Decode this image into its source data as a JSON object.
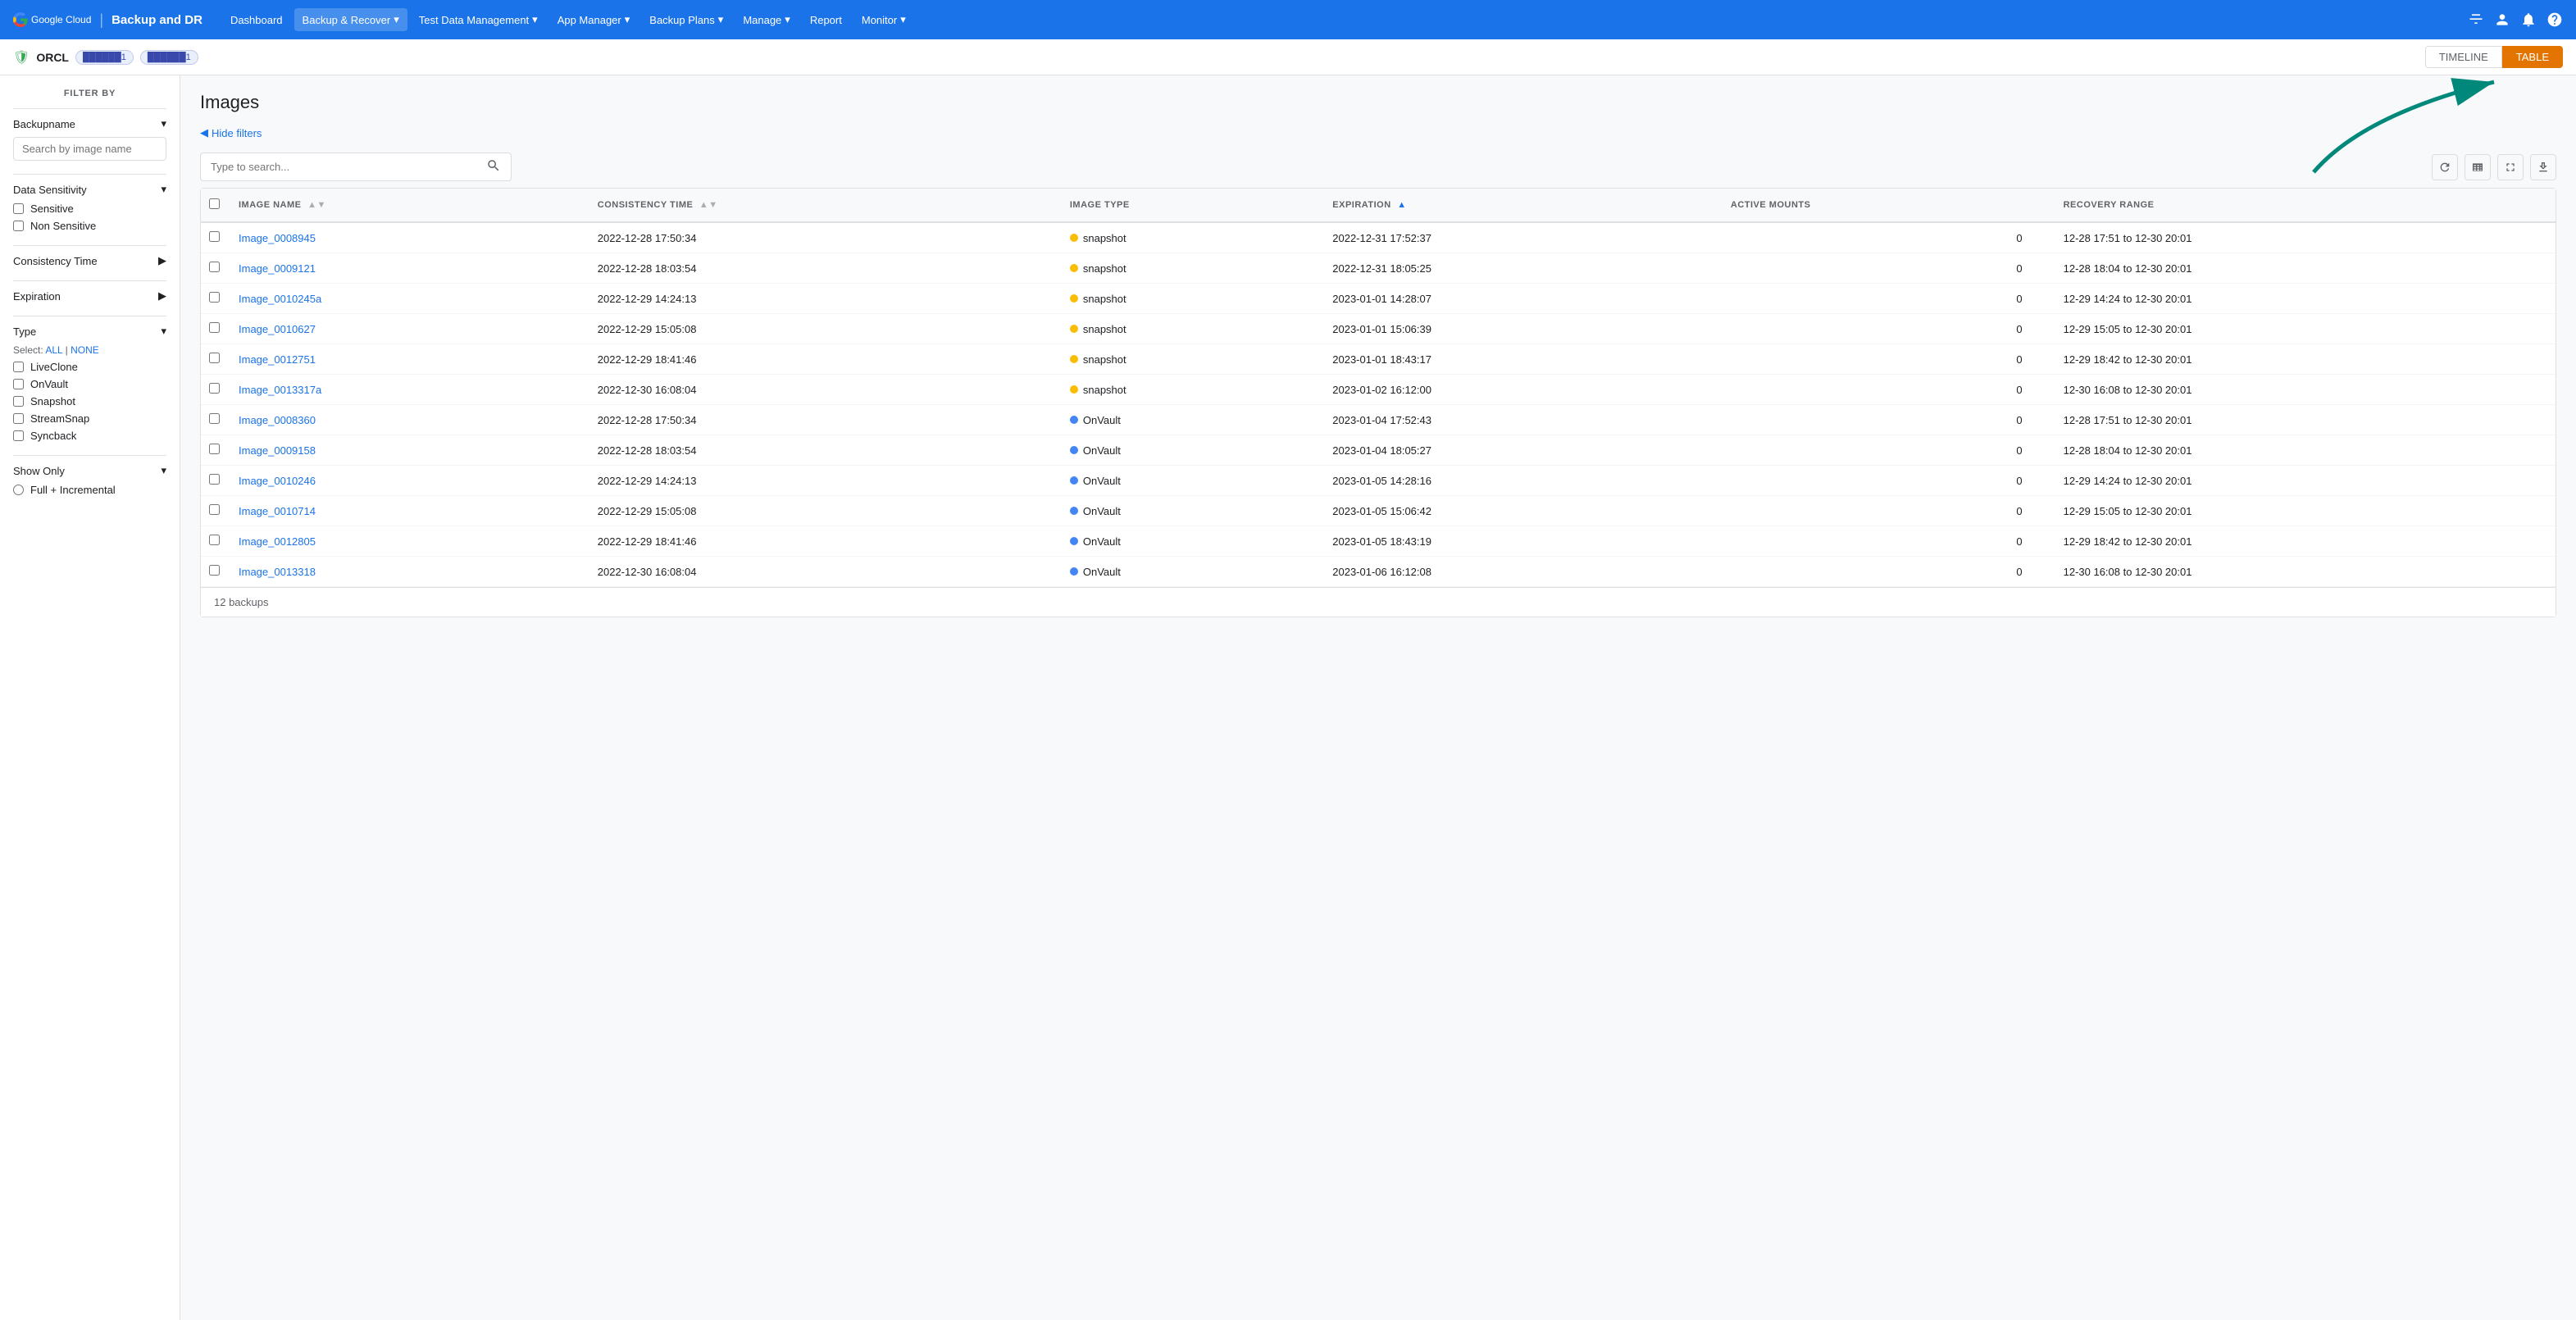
{
  "nav": {
    "brand": "Google Cloud",
    "product": "Backup and DR",
    "links": [
      {
        "label": "Dashboard",
        "hasDropdown": false
      },
      {
        "label": "Backup & Recover",
        "hasDropdown": true
      },
      {
        "label": "Test Data Management",
        "hasDropdown": true
      },
      {
        "label": "App Manager",
        "hasDropdown": true
      },
      {
        "label": "Backup Plans",
        "hasDropdown": true
      },
      {
        "label": "Manage",
        "hasDropdown": true
      },
      {
        "label": "Report",
        "hasDropdown": false
      },
      {
        "label": "Monitor",
        "hasDropdown": true
      }
    ]
  },
  "subnav": {
    "instance": "ORCL",
    "badge1": "●●●●●1",
    "badge2": "●●●●●1",
    "timeline_label": "TIMELINE",
    "table_label": "TABLE"
  },
  "sidebar": {
    "title": "FILTER BY",
    "sections": [
      {
        "label": "Backupname",
        "type": "search",
        "placeholder": "Search by image name"
      },
      {
        "label": "Data Sensitivity",
        "type": "checkboxes",
        "items": [
          "Sensitive",
          "Non Sensitive"
        ]
      },
      {
        "label": "Consistency Time",
        "type": "arrow"
      },
      {
        "label": "Expiration",
        "type": "arrow"
      },
      {
        "label": "Type",
        "type": "checkboxes_with_select",
        "select_all": "ALL",
        "select_none": "NONE",
        "items": [
          "LiveClone",
          "OnVault",
          "Snapshot",
          "StreamSnap",
          "Syncback"
        ]
      },
      {
        "label": "Show Only",
        "type": "radio",
        "items": [
          "Full + Incremental"
        ]
      }
    ]
  },
  "main": {
    "title": "Images",
    "hide_filters": "Hide filters",
    "search_placeholder": "Type to search...",
    "footer": "12 backups",
    "columns": [
      {
        "label": "IMAGE NAME",
        "sortable": true
      },
      {
        "label": "CONSISTENCY TIME",
        "sortable": true
      },
      {
        "label": "IMAGE TYPE",
        "sortable": false
      },
      {
        "label": "EXPIRATION",
        "sortable": true,
        "sort_dir": "desc"
      },
      {
        "label": "ACTIVE MOUNTS",
        "sortable": false
      },
      {
        "label": "RECOVERY RANGE",
        "sortable": false
      }
    ],
    "rows": [
      {
        "name": "Image_0008945",
        "consistency": "2022-12-28 17:50:34",
        "type": "snapshot",
        "expiration": "2022-12-31 17:52:37",
        "active_mounts": "0",
        "recovery_range": "12-28 17:51 to 12-30 20:01"
      },
      {
        "name": "Image_0009121",
        "consistency": "2022-12-28 18:03:54",
        "type": "snapshot",
        "expiration": "2022-12-31 18:05:25",
        "active_mounts": "0",
        "recovery_range": "12-28 18:04 to 12-30 20:01"
      },
      {
        "name": "Image_0010245a",
        "consistency": "2022-12-29 14:24:13",
        "type": "snapshot",
        "expiration": "2023-01-01 14:28:07",
        "active_mounts": "0",
        "recovery_range": "12-29 14:24 to 12-30 20:01"
      },
      {
        "name": "Image_0010627",
        "consistency": "2022-12-29 15:05:08",
        "type": "snapshot",
        "expiration": "2023-01-01 15:06:39",
        "active_mounts": "0",
        "recovery_range": "12-29 15:05 to 12-30 20:01"
      },
      {
        "name": "Image_0012751",
        "consistency": "2022-12-29 18:41:46",
        "type": "snapshot",
        "expiration": "2023-01-01 18:43:17",
        "active_mounts": "0",
        "recovery_range": "12-29 18:42 to 12-30 20:01"
      },
      {
        "name": "Image_0013317a",
        "consistency": "2022-12-30 16:08:04",
        "type": "snapshot",
        "expiration": "2023-01-02 16:12:00",
        "active_mounts": "0",
        "recovery_range": "12-30 16:08 to 12-30 20:01"
      },
      {
        "name": "Image_0008360",
        "consistency": "2022-12-28 17:50:34",
        "type": "OnVault",
        "expiration": "2023-01-04 17:52:43",
        "active_mounts": "0",
        "recovery_range": "12-28 17:51 to 12-30 20:01"
      },
      {
        "name": "Image_0009158",
        "consistency": "2022-12-28 18:03:54",
        "type": "OnVault",
        "expiration": "2023-01-04 18:05:27",
        "active_mounts": "0",
        "recovery_range": "12-28 18:04 to 12-30 20:01"
      },
      {
        "name": "Image_0010246",
        "consistency": "2022-12-29 14:24:13",
        "type": "OnVault",
        "expiration": "2023-01-05 14:28:16",
        "active_mounts": "0",
        "recovery_range": "12-29 14:24 to 12-30 20:01"
      },
      {
        "name": "Image_0010714",
        "consistency": "2022-12-29 15:05:08",
        "type": "OnVault",
        "expiration": "2023-01-05 15:06:42",
        "active_mounts": "0",
        "recovery_range": "12-29 15:05 to 12-30 20:01"
      },
      {
        "name": "Image_0012805",
        "consistency": "2022-12-29 18:41:46",
        "type": "OnVault",
        "expiration": "2023-01-05 18:43:19",
        "active_mounts": "0",
        "recovery_range": "12-29 18:42 to 12-30 20:01"
      },
      {
        "name": "Image_0013318",
        "consistency": "2022-12-30 16:08:04",
        "type": "OnVault",
        "expiration": "2023-01-06 16:12:08",
        "active_mounts": "0",
        "recovery_range": "12-30 16:08 to 12-30 20:01"
      }
    ]
  },
  "arrow": {
    "color": "#00897b"
  }
}
